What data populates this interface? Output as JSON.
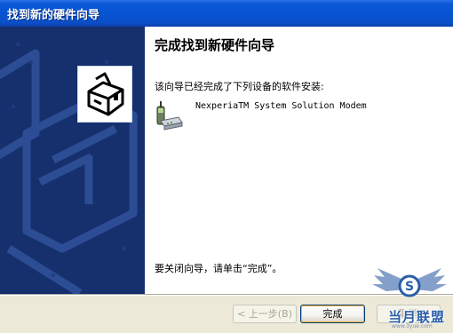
{
  "window": {
    "title": "找到新的硬件向导"
  },
  "sidebar": {
    "icon": "hardware-wizard-icon"
  },
  "content": {
    "heading": "完成找到新硬件向导",
    "description": "该向导已经完成了下列设备的软件安装:",
    "device": {
      "icon": "modem-phone-icon",
      "name": "NexperiaTM System Solution Modem"
    },
    "finish_hint": "要关闭向导，请单击“完成”。"
  },
  "buttons": {
    "back_label": "< 上一步(B)",
    "finish_label": "完成",
    "cancel_label": "取消"
  },
  "watermark": {
    "text": "当月联盟",
    "url": "www.3yue.com",
    "icon": "winged-s-logo-icon"
  },
  "colors": {
    "titlebar": "#0654d2",
    "sidebar": "#16306e",
    "dialog_bg": "#ece9d8"
  }
}
